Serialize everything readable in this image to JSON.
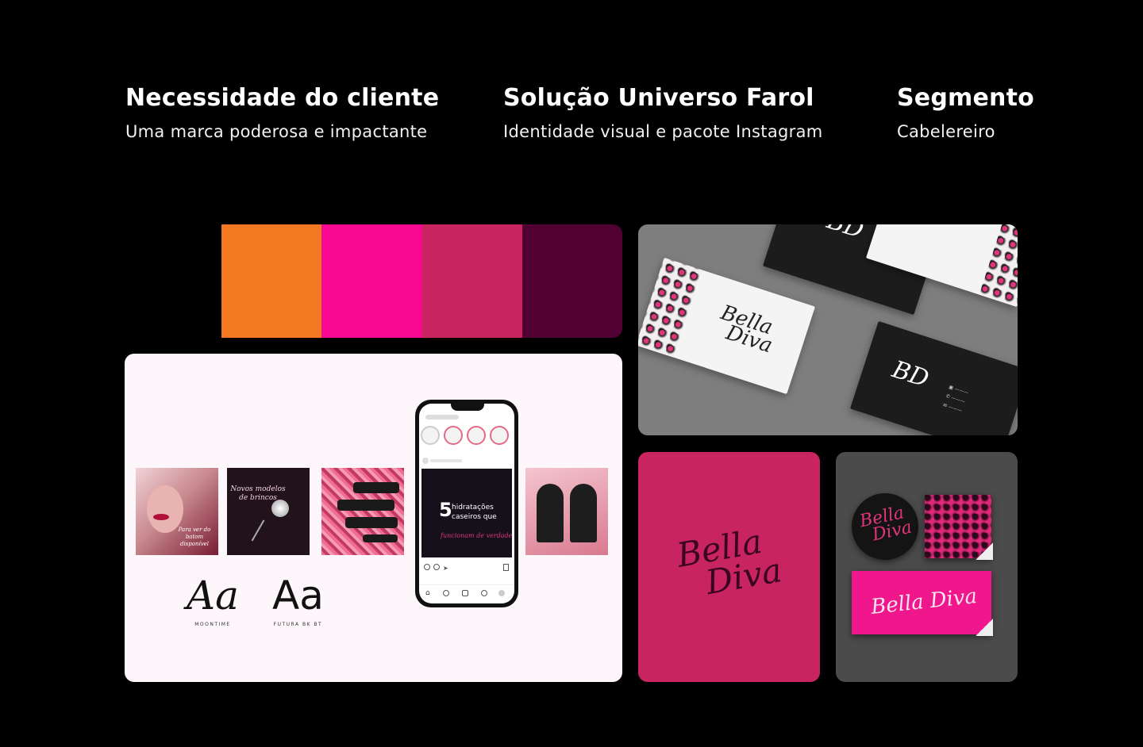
{
  "info": [
    {
      "title": "Necessidade do cliente",
      "subtitle": "Uma marca poderosa e impactante"
    },
    {
      "title": "Solução Universo Farol",
      "subtitle": "Identidade visual e pacote Instagram"
    },
    {
      "title": "Segmento",
      "subtitle": "Cabelereiro"
    }
  ],
  "palette": [
    "#f47721",
    "#f70890",
    "#c8245f",
    "#500031"
  ],
  "feed": {
    "thumb1": "Para ver do batom disponível",
    "thumb2": "Novos modelos de brincos",
    "phone_post": {
      "number": "5",
      "line1": "hidratações",
      "line2": "caseiros que",
      "script": "funcionam de verdade"
    },
    "fonts": [
      {
        "sample": "Aa",
        "name": "MOONTIME"
      },
      {
        "sample": "Aa",
        "name": "FUTURA BK BT"
      }
    ]
  },
  "cards": {
    "monogram": "BD",
    "brand_line1": "Bella",
    "brand_line2": "Diva"
  },
  "logo": {
    "line1": "Bella",
    "line2": "Diva",
    "color": "#c8245f"
  },
  "stickers": {
    "circle_line1": "Bella",
    "circle_line2": "Diva",
    "rect_text": "Bella Diva"
  }
}
